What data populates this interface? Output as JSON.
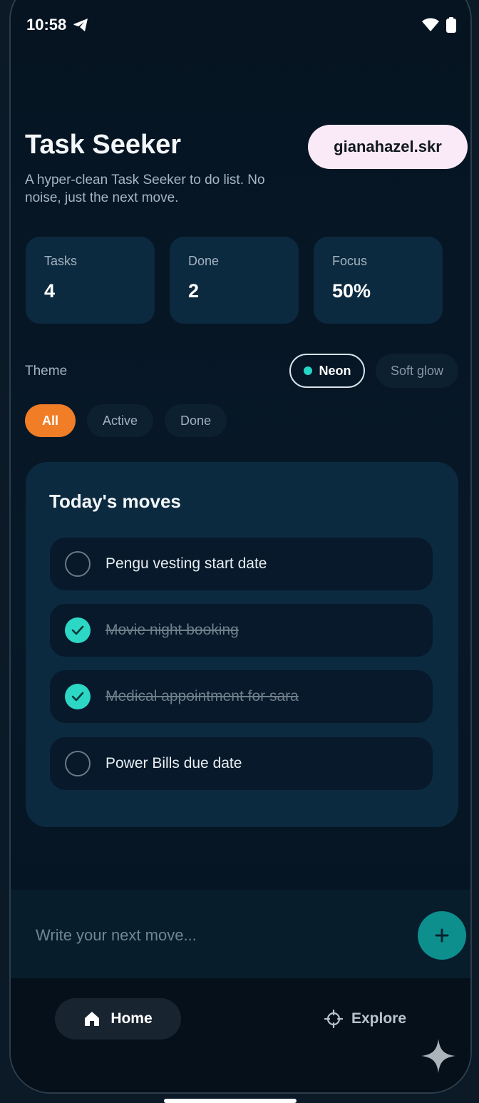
{
  "status": {
    "time": "10:58"
  },
  "header": {
    "title": "Task Seeker",
    "subtitle": "A hyper-clean Task Seeker to do list. No noise, just the next move.",
    "user": "gianahazel.skr"
  },
  "stats": [
    {
      "label": "Tasks",
      "value": "4"
    },
    {
      "label": "Done",
      "value": "2"
    },
    {
      "label": "Focus",
      "value": "50%"
    }
  ],
  "theme": {
    "label": "Theme",
    "options": [
      "Neon",
      "Soft glow"
    ],
    "selected": "Neon"
  },
  "filters": {
    "options": [
      "All",
      "Active",
      "Done"
    ],
    "selected": "All"
  },
  "tasks_card": {
    "title": "Today's moves",
    "items": [
      {
        "text": "Pengu vesting start date",
        "done": false
      },
      {
        "text": "Movie night booking",
        "done": true
      },
      {
        "text": "Medical appointment for sara",
        "done": true
      },
      {
        "text": "Power Bills due date",
        "done": false
      }
    ]
  },
  "compose": {
    "placeholder": "Write your next move..."
  },
  "nav": {
    "home": "Home",
    "explore": "Explore"
  },
  "colors": {
    "accent": "#2dd7c5",
    "filter_active": "#f27d27",
    "user_chip": "#fae9f6"
  }
}
